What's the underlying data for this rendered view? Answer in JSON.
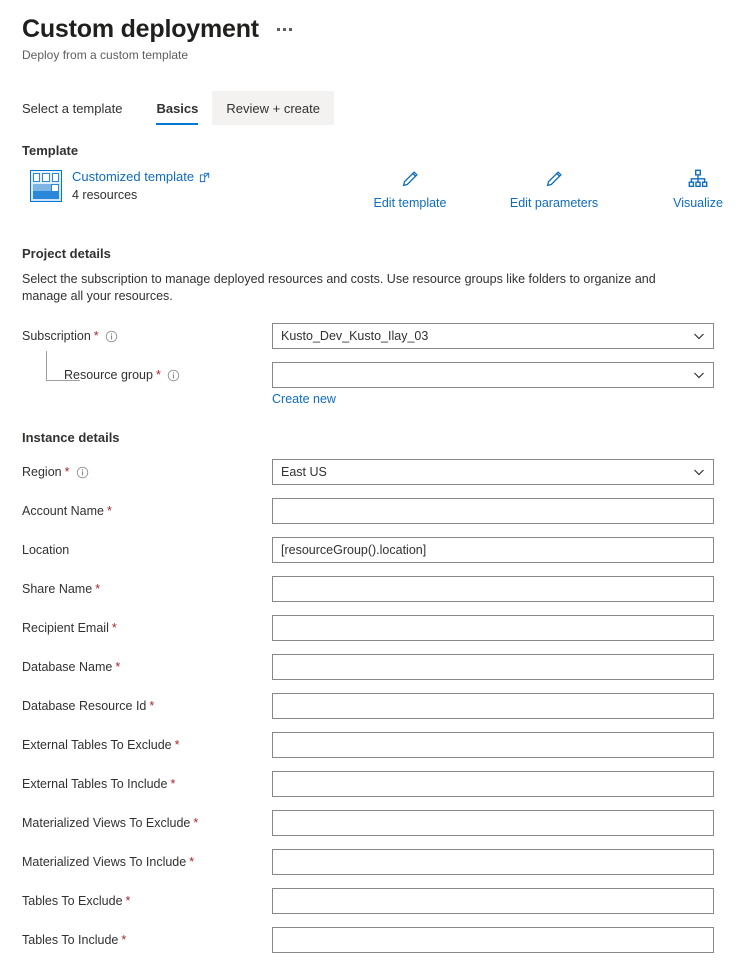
{
  "header": {
    "title": "Custom deployment",
    "subtitle": "Deploy from a custom template",
    "more_menu": "more-options"
  },
  "tabs": [
    {
      "label": "Select a template",
      "state": "normal"
    },
    {
      "label": "Basics",
      "state": "active"
    },
    {
      "label": "Review + create",
      "state": "hovered"
    }
  ],
  "template": {
    "heading": "Template",
    "link_label": "Customized template",
    "resources_count": "4 resources",
    "actions": [
      {
        "label": "Edit template",
        "icon": "pencil-icon"
      },
      {
        "label": "Edit parameters",
        "icon": "pencil-icon"
      },
      {
        "label": "Visualize",
        "icon": "hierarchy-icon"
      }
    ]
  },
  "project_details": {
    "heading": "Project details",
    "description": "Select the subscription to manage deployed resources and costs. Use resource groups like folders to organize and manage all your resources.",
    "subscription": {
      "label": "Subscription",
      "required": "*",
      "value": "Kusto_Dev_Kusto_Ilay_03"
    },
    "resource_group": {
      "label": "Resource group",
      "required": "*",
      "value": "",
      "create_new": "Create new"
    }
  },
  "instance_details": {
    "heading": "Instance details",
    "fields": [
      {
        "label": "Region",
        "required": "*",
        "value": "East US",
        "type": "select"
      },
      {
        "label": "Account Name",
        "required": "*",
        "value": "",
        "type": "text"
      },
      {
        "label": "Location",
        "required": "",
        "value": "[resourceGroup().location]",
        "type": "text"
      },
      {
        "label": "Share Name",
        "required": "*",
        "value": "",
        "type": "text"
      },
      {
        "label": "Recipient Email",
        "required": "*",
        "value": "",
        "type": "text"
      },
      {
        "label": "Database Name",
        "required": "*",
        "value": "",
        "type": "text"
      },
      {
        "label": "Database Resource Id",
        "required": "*",
        "value": "",
        "type": "text"
      },
      {
        "label": "External Tables To Exclude",
        "required": "*",
        "value": "",
        "type": "text"
      },
      {
        "label": "External Tables To Include",
        "required": "*",
        "value": "",
        "type": "text"
      },
      {
        "label": "Materialized Views To Exclude",
        "required": "*",
        "value": "",
        "type": "text"
      },
      {
        "label": "Materialized Views To Include",
        "required": "*",
        "value": "",
        "type": "text"
      },
      {
        "label": "Tables To Exclude",
        "required": "*",
        "value": "",
        "type": "text"
      },
      {
        "label": "Tables To Include",
        "required": "*",
        "value": "",
        "type": "text"
      }
    ]
  },
  "colors": {
    "accent": "#0078d4",
    "link": "#0f6cbd",
    "required": "#a4262c",
    "border": "#8a8886",
    "text": "#323130"
  }
}
